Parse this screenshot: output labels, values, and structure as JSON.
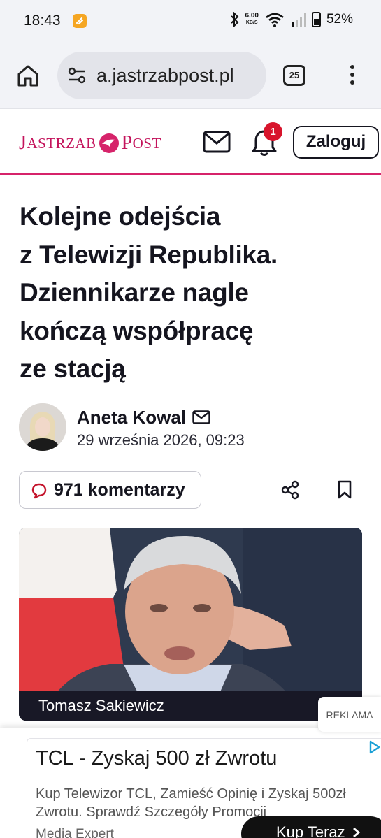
{
  "status_bar": {
    "time": "18:43",
    "network_speed_value": "6.00",
    "network_speed_unit": "KB/S",
    "battery": "52%"
  },
  "browser": {
    "url": "a.jastrzabpost.pl",
    "tab_count": "25"
  },
  "site": {
    "logo_part1": "J",
    "logo_part2": "ASTRZAB",
    "logo_part3": "P",
    "logo_part4": "OST",
    "notification_count": "1",
    "login_label": "Zaloguj",
    "brand_color": "#d6236a"
  },
  "article": {
    "headline_lines": [
      "Kolejne odejścia",
      "z Telewizji Republika.",
      "Dziennikarze nagle",
      "kończą współpracę",
      "ze stacją"
    ],
    "author": "Aneta Kowal",
    "date": "29 września 2026, 09:23",
    "comments_label": "971 komentarzy",
    "image_caption": "Tomasz Sakiewicz"
  },
  "ad": {
    "tag": "REKLAMA",
    "title": "TCL - Zyskaj 500 zł Zwrotu",
    "description": "Kup Telewizor TCL, Zamieść Opinię i Zyskaj 500zł Zwrotu. Sprawdź Szczegóły Promocji",
    "source": "Media Expert",
    "cta_label": "Kup Teraz"
  }
}
